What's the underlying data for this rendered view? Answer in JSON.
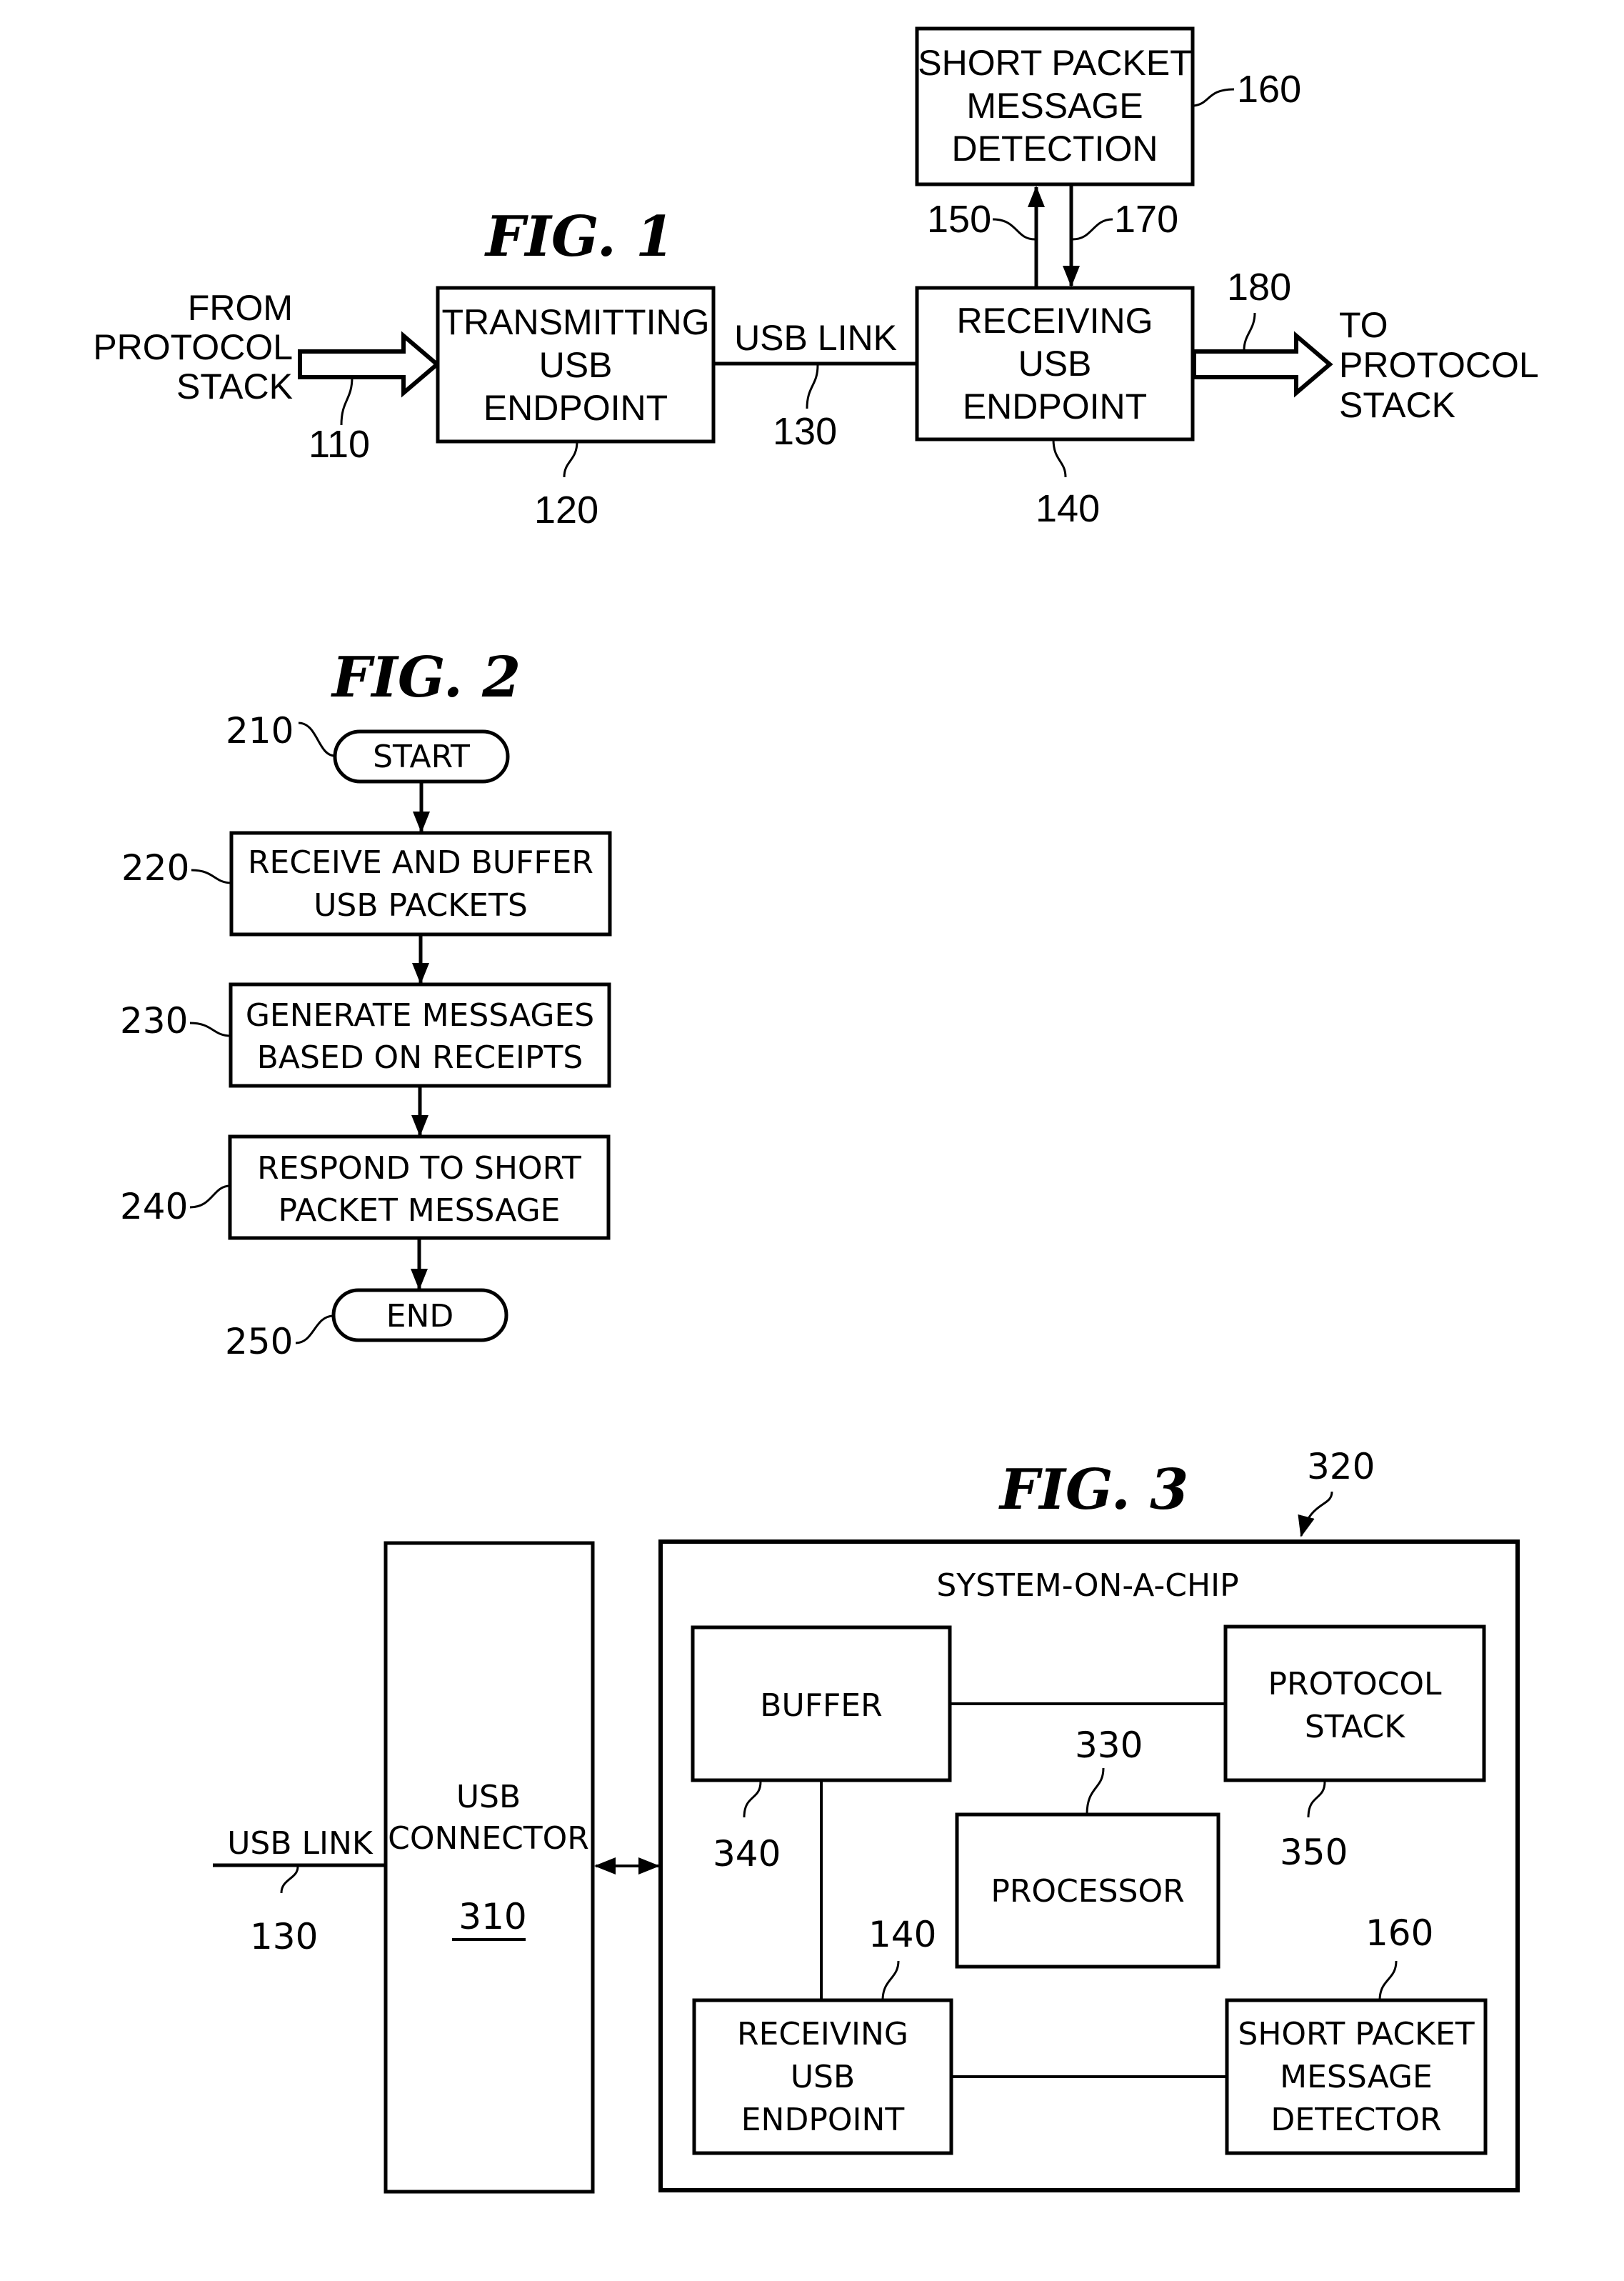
{
  "fig1": {
    "title": "FIG. 1",
    "from_label": [
      "FROM",
      "PROTOCOL",
      "STACK"
    ],
    "to_label": [
      "TO",
      "PROTOCOL",
      "STACK"
    ],
    "transmitting": [
      "TRANSMITTING",
      "USB",
      "ENDPOINT"
    ],
    "receiving": [
      "RECEIVING",
      "USB",
      "ENDPOINT"
    ],
    "detection": [
      "SHORT PACKET",
      "MESSAGE",
      "DETECTION"
    ],
    "link_label": "USB LINK",
    "refs": {
      "r110": "110",
      "r120": "120",
      "r130": "130",
      "r140": "140",
      "r150": "150",
      "r160": "160",
      "r170": "170",
      "r180": "180"
    }
  },
  "fig2": {
    "title": "FIG. 2",
    "start": "START",
    "end": "END",
    "steps": [
      [
        "RECEIVE AND BUFFER",
        "USB PACKETS"
      ],
      [
        "GENERATE MESSAGES",
        "BASED ON RECEIPTS"
      ],
      [
        "RESPOND TO SHORT",
        "PACKET MESSAGE"
      ]
    ],
    "refs": {
      "r210": "210",
      "r220": "220",
      "r230": "230",
      "r240": "240",
      "r250": "250"
    }
  },
  "fig3": {
    "title": "FIG. 3",
    "link_label": "USB LINK",
    "connector": [
      "USB",
      "CONNECTOR"
    ],
    "connector_ref": "310",
    "soc_label": "SYSTEM-ON-A-CHIP",
    "buffer": "BUFFER",
    "protocol": [
      "PROTOCOL",
      "STACK"
    ],
    "processor": "PROCESSOR",
    "receiving": [
      "RECEIVING",
      "USB",
      "ENDPOINT"
    ],
    "detector": [
      "SHORT PACKET",
      "MESSAGE",
      "DETECTOR"
    ],
    "refs": {
      "r130": "130",
      "r320": "320",
      "r330": "330",
      "r340": "340",
      "r350": "350",
      "r140": "140",
      "r160": "160"
    }
  }
}
